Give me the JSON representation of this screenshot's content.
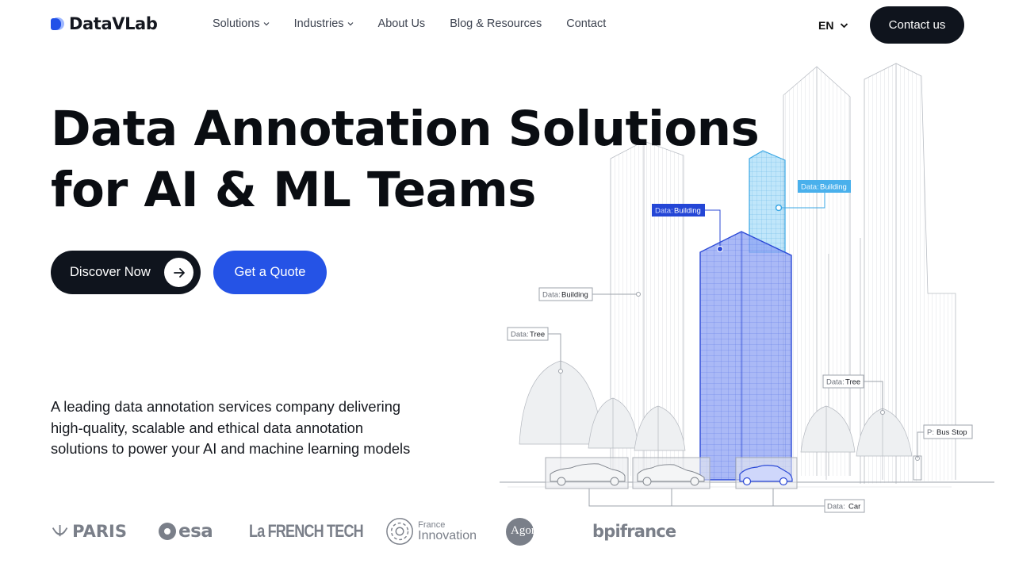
{
  "brand": {
    "name": "DataVLab"
  },
  "nav": {
    "items": [
      {
        "label": "Solutions",
        "has_dropdown": true
      },
      {
        "label": "Industries",
        "has_dropdown": true
      },
      {
        "label": "About Us",
        "has_dropdown": false
      },
      {
        "label": "Blog & Resources",
        "has_dropdown": false
      },
      {
        "label": "Contact",
        "has_dropdown": false
      }
    ],
    "language": "EN",
    "cta_label": "Contact us"
  },
  "hero": {
    "title_line1": "Data Annotation Solutions",
    "title_line2": "for AI & ML Teams",
    "primary_button": "Discover Now",
    "secondary_button": "Get a Quote",
    "description": "A leading data annotation services company delivering high-quality, scalable and ethical data annotation solutions to power your AI and machine learning models"
  },
  "illustration": {
    "labels": {
      "building_highlight_dark": {
        "prefix": "Data:",
        "value": "Building"
      },
      "building_highlight_light": {
        "prefix": "Data:",
        "value": "Building"
      },
      "building_left": {
        "prefix": "Data:",
        "value": "Building"
      },
      "tree_left": {
        "prefix": "Data:",
        "value": "Tree"
      },
      "tree_right": {
        "prefix": "Data:",
        "value": "Tree"
      },
      "bus_stop": {
        "prefix": "P:",
        "value": "Bus Stop"
      },
      "car": {
        "prefix": "Data:",
        "value": "Car"
      }
    }
  },
  "partners": {
    "logos": [
      {
        "name": "paris-logo",
        "text": "PARIS"
      },
      {
        "name": "esa-logo",
        "text": "esa"
      },
      {
        "name": "french-tech-logo",
        "text": "La FRENCH TECH"
      },
      {
        "name": "france-innovation-logo",
        "text_top": "France",
        "text_bottom": "Innovation"
      },
      {
        "name": "agoranov-logo",
        "text": "Agoranov"
      },
      {
        "name": "bpifrance-logo",
        "text": "bpifrance"
      }
    ]
  },
  "colors": {
    "dark": "#0f141d",
    "accent_blue": "#2553e6",
    "highlight_dark_blue": "#3d5ce0",
    "highlight_light_blue": "#4fb3ea",
    "muted_gray": "#7a7f89"
  }
}
